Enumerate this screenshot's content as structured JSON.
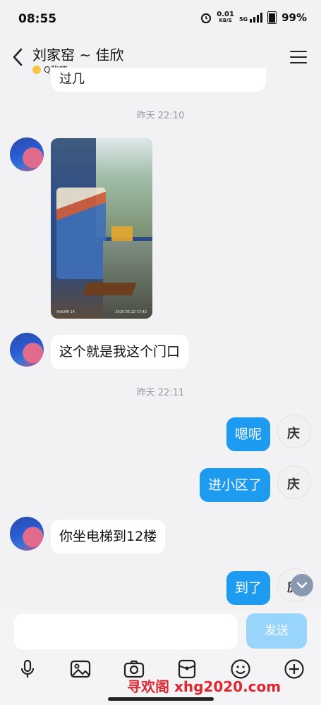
{
  "status": {
    "time": "08:55",
    "net_rate": "0.01",
    "net_unit": "KB/S",
    "net_type": "5G",
    "battery": "99%"
  },
  "header": {
    "title": "刘家窑 ~ 佳欣",
    "subtitle": "Q我吧"
  },
  "messages": {
    "partial": "过几",
    "ts1": "昨天 22:10",
    "photo_caption_left": "XIAOMI 14",
    "photo_caption_right": "2025.05.22 17:42",
    "m2": "这个就是我这个门口",
    "ts2": "昨天 22:11",
    "m3": "嗯呢",
    "m4": "进小区了",
    "m5": "你坐电梯到12楼",
    "m6": "到了"
  },
  "composer": {
    "send_label": "发送"
  },
  "watermark": "寻欢阁 xhg2020.com",
  "colors": {
    "accent": "#1d9bf0",
    "send_disabled": "#99d5fb",
    "background": "#f2f2f5"
  },
  "icons": [
    "back-arrow-icon",
    "menu-icon",
    "mic-icon",
    "image-icon",
    "camera-icon",
    "red-packet-icon",
    "emoji-icon",
    "plus-icon",
    "chevron-down-icon"
  ]
}
